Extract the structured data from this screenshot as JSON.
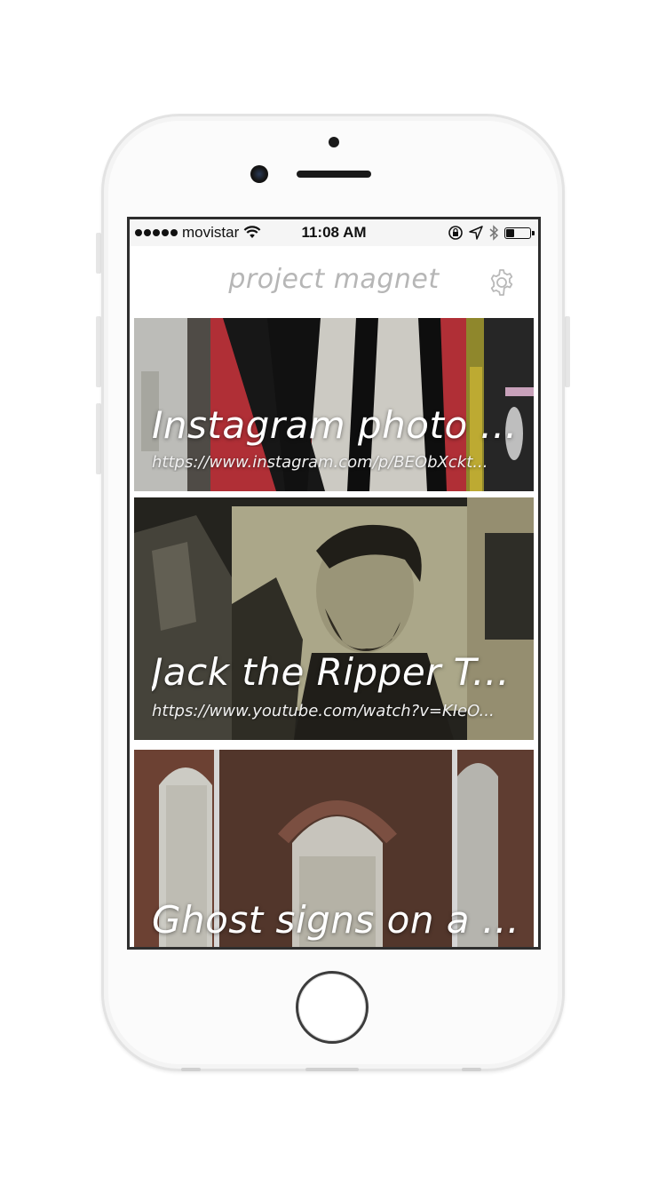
{
  "status_bar": {
    "carrier": "movistar",
    "time": "11:08 AM",
    "signal_icon": "signal-dots-icon",
    "wifi_icon": "wifi-icon",
    "right_icons": [
      "rotation-lock-icon",
      "location-arrow-icon",
      "bluetooth-icon",
      "battery-icon"
    ]
  },
  "navbar": {
    "title": "project magnet",
    "settings_icon": "gear-icon"
  },
  "cards": [
    {
      "title": "Instagram photo b...",
      "url": "https://www.instagram.com/p/BEObXckt..."
    },
    {
      "title": "Jack the Ripper Tou...",
      "url": "https://www.youtube.com/watch?v=KIeO..."
    },
    {
      "title": "Ghost signs on a fo..."
    }
  ],
  "device": {
    "home_button_icon": "home-button-icon"
  },
  "colors": {
    "nav_title": "#b6b6b6",
    "card_text": "#ffffff"
  }
}
